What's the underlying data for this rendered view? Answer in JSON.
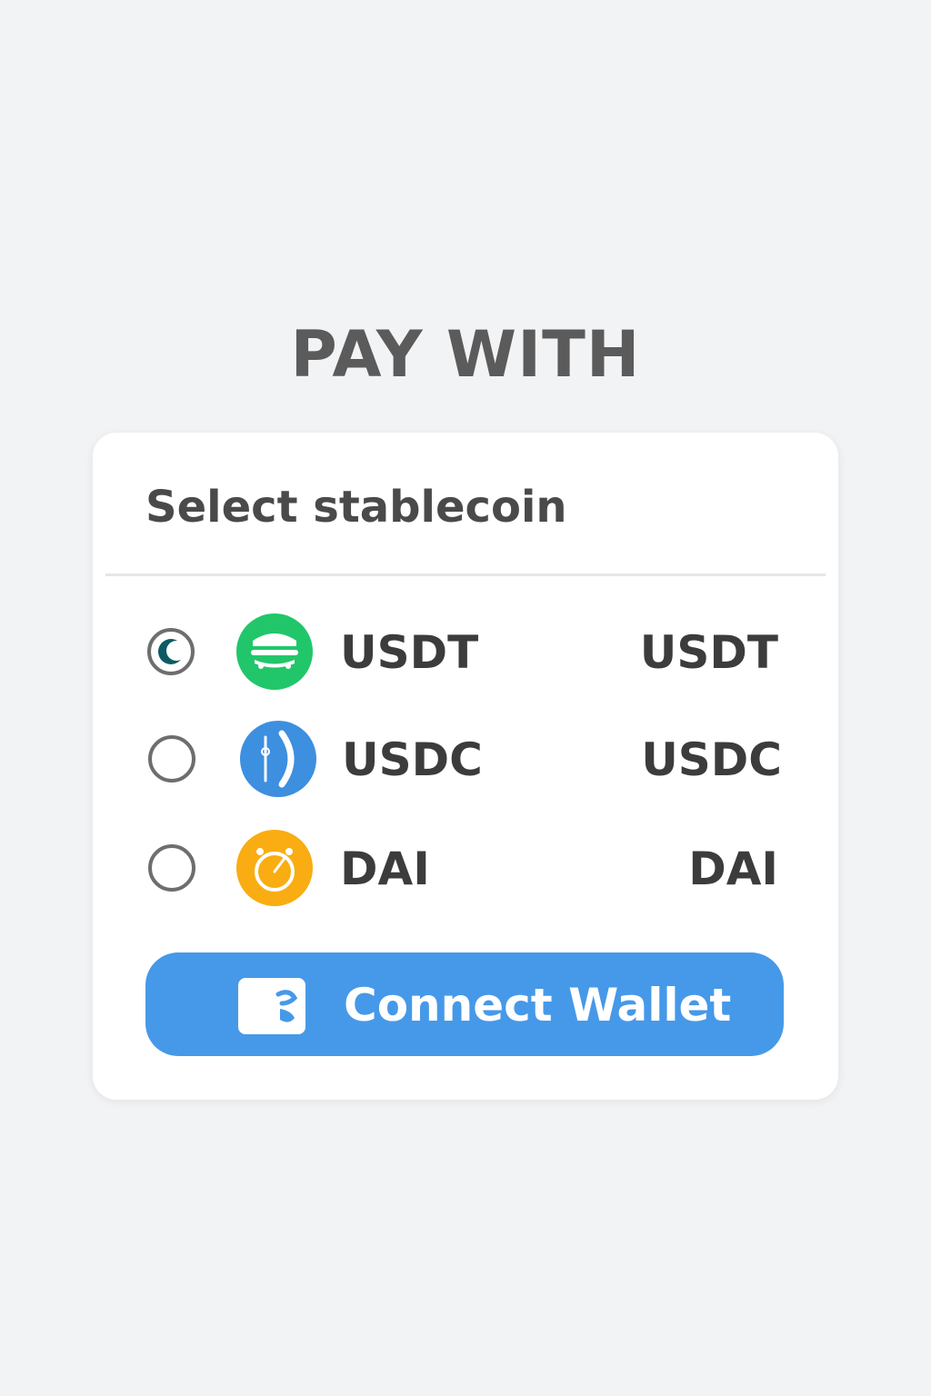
{
  "page": {
    "title": "PAY WITH"
  },
  "card": {
    "header": "Select stablecoin",
    "coins": [
      {
        "name": "USDT",
        "ticker": "USDT",
        "selected": true,
        "icon": "usdt-icon",
        "color": "#22c66a"
      },
      {
        "name": "USDC",
        "ticker": "USDC",
        "selected": false,
        "icon": "usdc-icon",
        "color": "#3d8fe0"
      },
      {
        "name": "DAI",
        "ticker": "DAI",
        "selected": false,
        "icon": "dai-icon",
        "color": "#f9ad12"
      }
    ],
    "connect_button": {
      "label": "Connect Wallet",
      "icon": "wallet-icon",
      "color": "#4699e8"
    }
  }
}
